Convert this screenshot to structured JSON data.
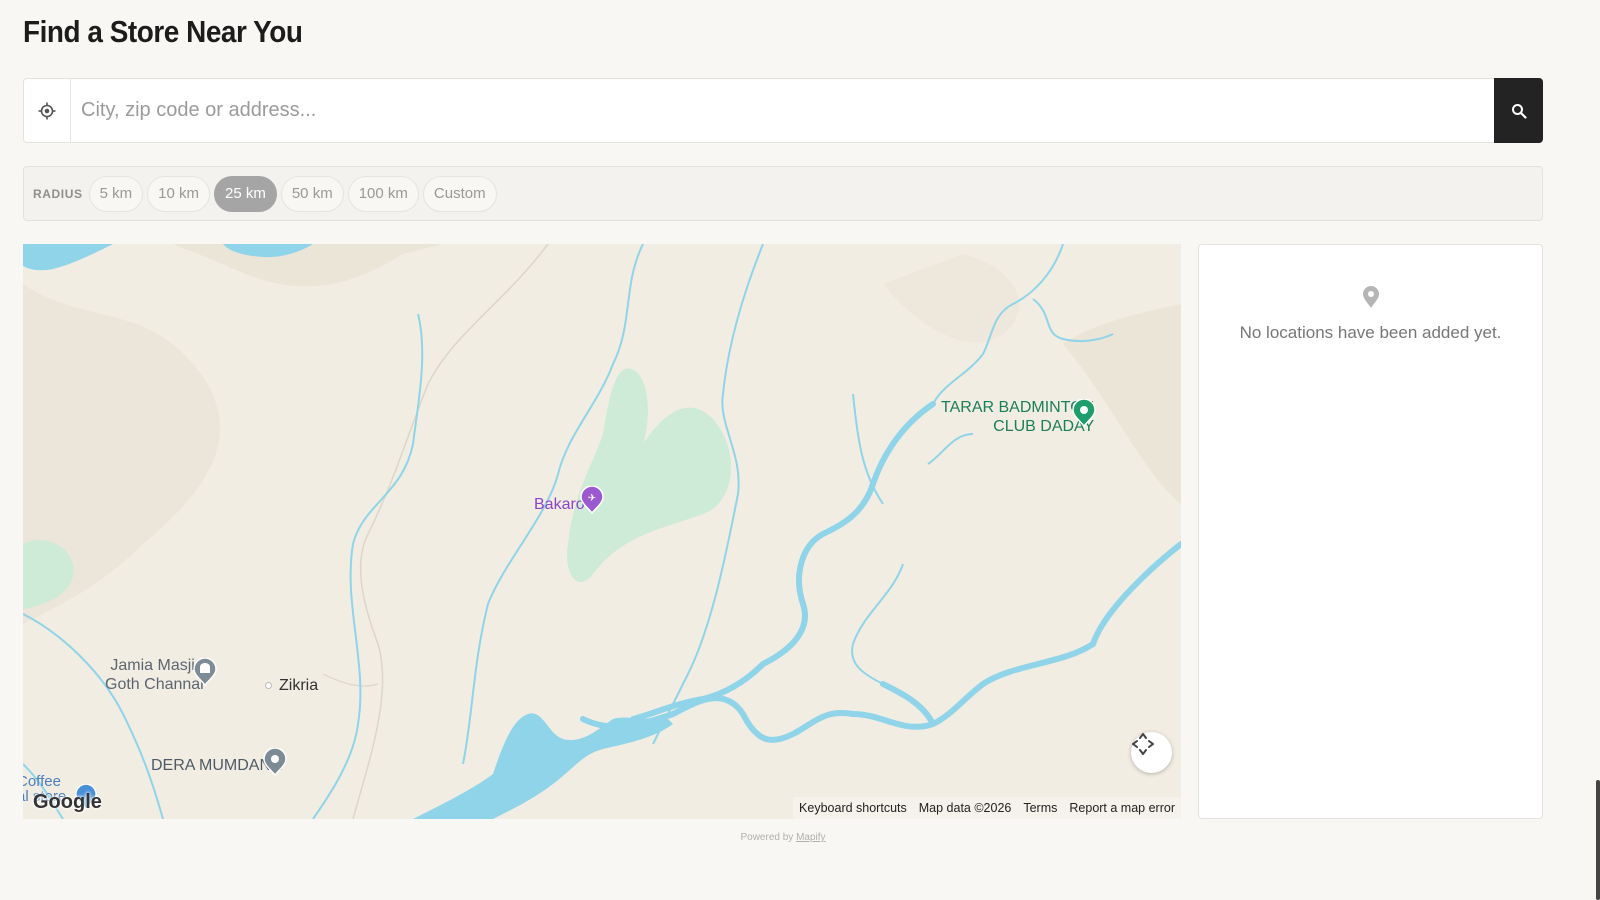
{
  "page": {
    "title": "Find a Store Near You"
  },
  "search": {
    "placeholder": "City, zip code or address...",
    "locate_icon": "crosshair-icon",
    "search_icon": "search-icon"
  },
  "radius": {
    "label": "RADIUS",
    "options": [
      "5 km",
      "10 km",
      "25 km",
      "50 km",
      "100 km",
      "Custom"
    ],
    "selected": "25 km"
  },
  "map": {
    "places": {
      "bakaro": "Bakaro",
      "tarar_line1": "TARAR BADMINTON",
      "tarar_line2": "CLUB DADAY",
      "jamia_line1": "Jamia Masjid",
      "jamia_line2": "Goth Channal",
      "zikria": "Zikria",
      "dera": "DERA MUMDANA",
      "edge_line1": "Coffee",
      "edge_line2": "al store"
    },
    "google_logo": "Google",
    "attribution": {
      "keyboard": "Keyboard shortcuts",
      "map_data": "Map data ©2026",
      "terms": "Terms",
      "report": "Report a map error"
    },
    "colors": {
      "land": "#f2ede3",
      "water": "#8fd4e8",
      "park": "#cdebd7",
      "poi_purple": "#9b59d0",
      "poi_green": "#1e9e6a",
      "poi_gray": "#7d8b97"
    }
  },
  "results": {
    "empty_message": "No locations have been added yet.",
    "icon": "map-pin-icon"
  },
  "footer": {
    "powered_prefix": "Powered by",
    "powered_link": "Mapify"
  }
}
